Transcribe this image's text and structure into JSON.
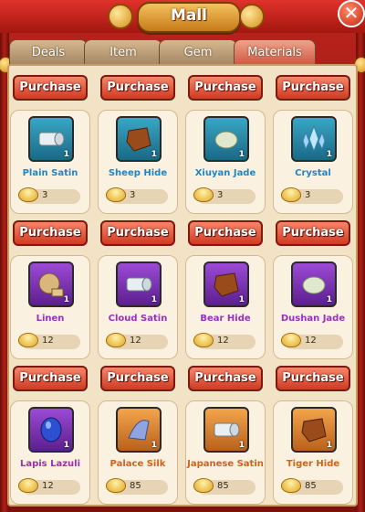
{
  "window": {
    "title": "Mall",
    "close_label": "✕"
  },
  "tabs": [
    {
      "label": "Deals",
      "active": false
    },
    {
      "label": "Item",
      "active": false
    },
    {
      "label": "Gem",
      "active": false
    },
    {
      "label": "Materials",
      "active": true
    }
  ],
  "purchase_label": "Purchase",
  "items": [
    {
      "name": "Plain Satin",
      "qty": "1",
      "price": "3",
      "rarity": "blue",
      "icon": "satin-cloth-icon"
    },
    {
      "name": "Sheep Hide",
      "qty": "1",
      "price": "3",
      "rarity": "blue",
      "icon": "hide-icon"
    },
    {
      "name": "Xiuyan Jade",
      "qty": "1",
      "price": "3",
      "rarity": "blue",
      "icon": "jade-icon"
    },
    {
      "name": "Crystal",
      "qty": "1",
      "price": "3",
      "rarity": "blue",
      "icon": "crystal-icon"
    },
    {
      "name": "Linen",
      "qty": "1",
      "price": "12",
      "rarity": "purple",
      "icon": "linen-icon"
    },
    {
      "name": "Cloud Satin",
      "qty": "1",
      "price": "12",
      "rarity": "purple",
      "icon": "satin-cloth-icon"
    },
    {
      "name": "Bear Hide",
      "qty": "1",
      "price": "12",
      "rarity": "purple",
      "icon": "hide-icon"
    },
    {
      "name": "Dushan Jade",
      "qty": "1",
      "price": "12",
      "rarity": "purple",
      "icon": "jade-icon"
    },
    {
      "name": "Lapis Lazuli",
      "qty": "1",
      "price": "12",
      "rarity": "purple",
      "icon": "gem-icon"
    },
    {
      "name": "Palace Silk",
      "qty": "1",
      "price": "85",
      "rarity": "orange",
      "icon": "silk-icon"
    },
    {
      "name": "Japanese Satin",
      "qty": "1",
      "price": "85",
      "rarity": "orange",
      "icon": "satin-cloth-icon"
    },
    {
      "name": "Tiger Hide",
      "qty": "1",
      "price": "85",
      "rarity": "orange",
      "icon": "hide-icon"
    }
  ],
  "colors": {
    "accent": "#cf3a23",
    "rarity_blue": "#1d86c7",
    "rarity_purple": "#9a2fbb",
    "rarity_orange": "#d6601a",
    "currency": "#e0a622"
  },
  "currency_icon": "gold-ingot-icon"
}
